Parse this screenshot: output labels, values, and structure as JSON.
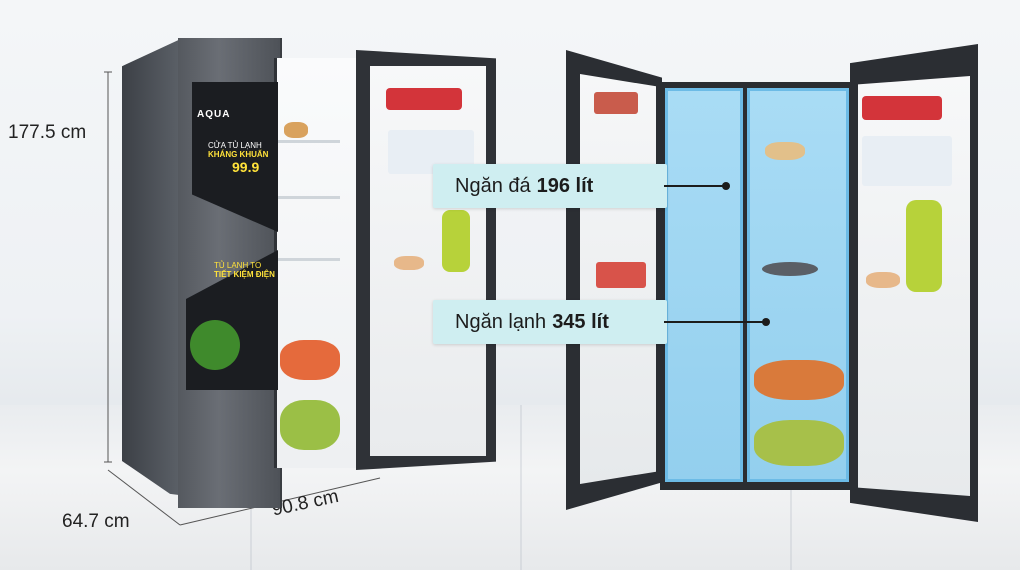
{
  "dimensions": {
    "height": "177.5 cm",
    "depth": "64.7 cm",
    "width": "90.8 cm"
  },
  "brand": "AQUA",
  "decal": {
    "top_line1": "CỬA TỦ LẠNH",
    "top_line2": "KHÁNG KHUẨN",
    "top_value": "99.9",
    "bottom_line1": "TỦ LẠNH TO",
    "bottom_line2": "TIẾT KIỆM ĐIỆN"
  },
  "callouts": {
    "freezer_label": "Ngăn đá",
    "freezer_value": "196 lít",
    "fridge_label": "Ngăn lạnh",
    "fridge_value": "345 lít"
  },
  "colors": {
    "callout_bg": "#cfeef1",
    "compartment_highlight": "#a9dcf5",
    "fridge_body": "#4a4e54"
  }
}
